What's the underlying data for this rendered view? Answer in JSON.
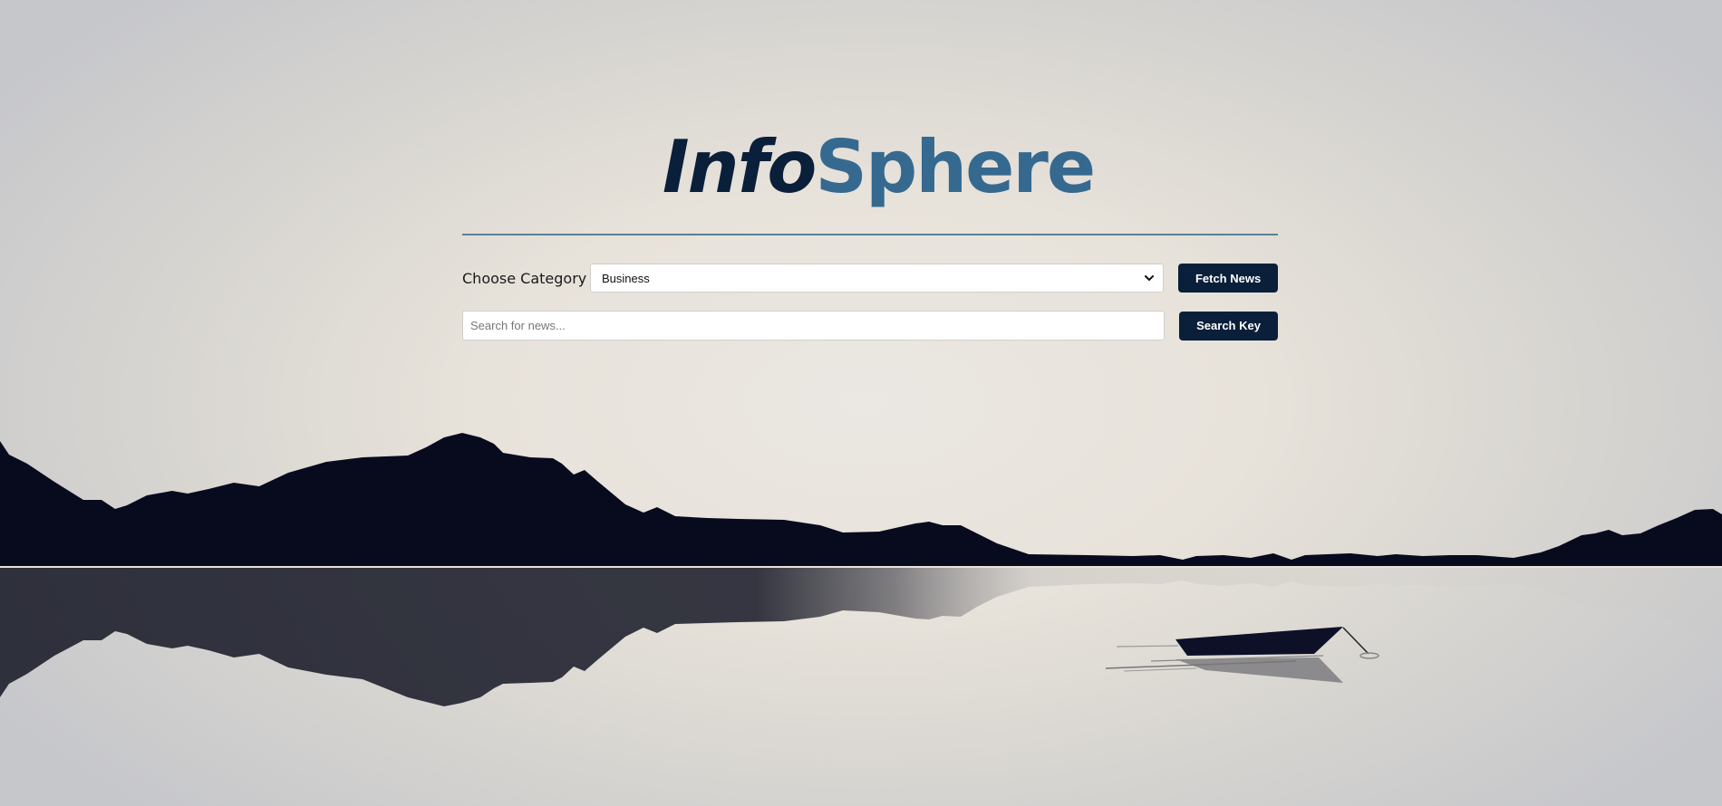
{
  "logo": {
    "part_1": "Info",
    "part_2": "Sphere"
  },
  "category": {
    "label": "Choose Category :",
    "selected": "Business"
  },
  "fetch_button": {
    "label": "Fetch News"
  },
  "search": {
    "placeholder": "Search for news...",
    "value": ""
  },
  "search_button": {
    "label": "Search Key"
  },
  "colors": {
    "navy": "#0a1f3a",
    "steel_blue": "#36698f",
    "silhouette": "#080a1e"
  },
  "icons": {
    "select_chevron": "chevron-down-icon"
  }
}
